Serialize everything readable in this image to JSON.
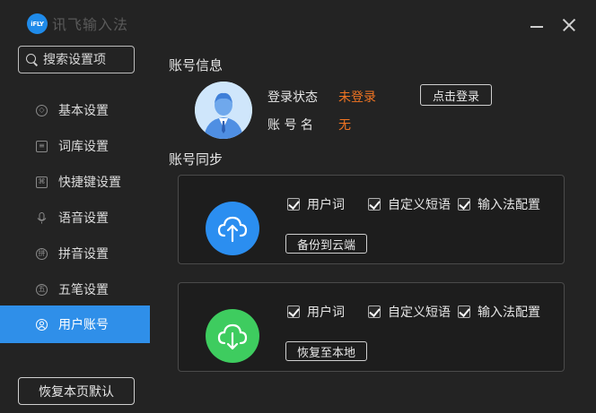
{
  "app": {
    "logo_text": "iFLY",
    "title": "讯飞输入法"
  },
  "window": {
    "minimize_icon": "minimize-icon",
    "close_icon": "close-icon"
  },
  "search": {
    "placeholder": "搜索设置项",
    "value": ""
  },
  "sidebar": {
    "items": [
      {
        "label": "基本设置",
        "icon": "hexagon-icon",
        "glyph": "◇",
        "active": false
      },
      {
        "label": "词库设置",
        "icon": "dictionary-icon",
        "glyph": "≡",
        "active": false
      },
      {
        "label": "快捷键设置",
        "icon": "shortcut-key-icon",
        "glyph": "⌘",
        "active": false
      },
      {
        "label": "语音设置",
        "icon": "microphone-icon",
        "glyph": "",
        "active": false
      },
      {
        "label": "拼音设置",
        "icon": "pinyin-icon",
        "glyph": "拼",
        "active": false
      },
      {
        "label": "五笔设置",
        "icon": "wubi-icon",
        "glyph": "五",
        "active": false
      },
      {
        "label": "用户账号",
        "icon": "user-account-icon",
        "glyph": "",
        "active": true
      }
    ],
    "restore_label": "恢复本页默认"
  },
  "account": {
    "section_title": "账号信息",
    "status_label": "登录状态",
    "status_value": "未登录",
    "name_label": "账 号 名",
    "name_value": "无",
    "login_button": "点击登录",
    "value_color": "#f07422"
  },
  "sync": {
    "section_title": "账号同步",
    "upload": {
      "icon": "cloud-upload-icon",
      "color": "#2b8ef0",
      "options": [
        "用户词",
        "自定义短语",
        "输入法配置"
      ],
      "checked": [
        true,
        true,
        true
      ],
      "button": "备份到云端"
    },
    "download": {
      "icon": "cloud-download-icon",
      "color": "#3ecc5f",
      "options": [
        "用户词",
        "自定义短语",
        "输入法配置"
      ],
      "checked": [
        true,
        true,
        true
      ],
      "button": "恢复至本地"
    }
  }
}
